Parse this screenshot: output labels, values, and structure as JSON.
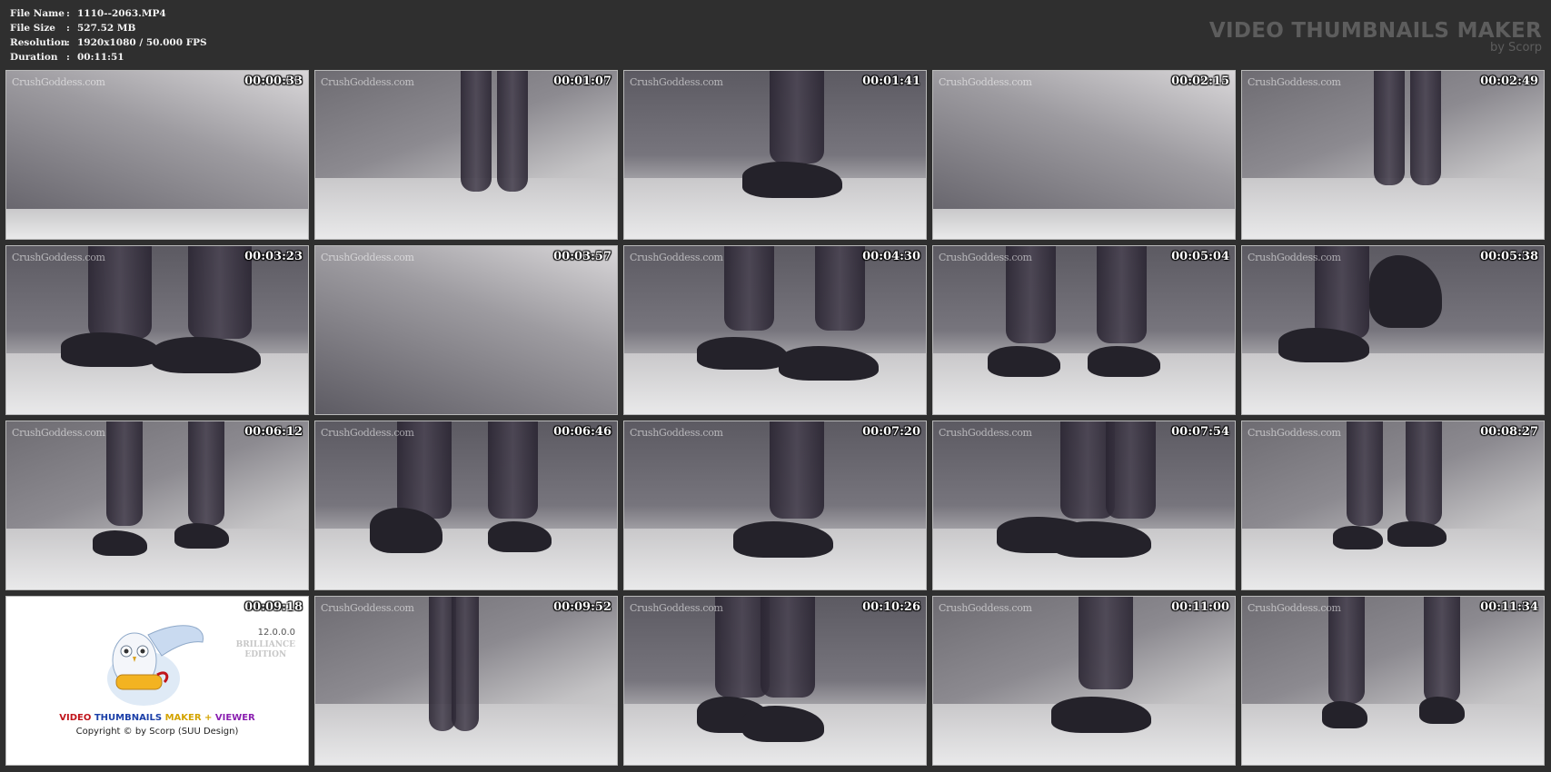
{
  "info": {
    "rows": [
      {
        "key": "File Name",
        "sep": ":",
        "value": "1110--2063.MP4"
      },
      {
        "key": "File Size",
        "sep": ":",
        "value": "527.52 MB"
      },
      {
        "key": "Resolution",
        "sep": ":",
        "value": "1920x1080 / 50.000 FPS"
      },
      {
        "key": "Duration",
        "sep": ":",
        "value": "00:11:51"
      }
    ]
  },
  "brand": {
    "title": "VIDEO THUMBNAILS MAKER",
    "subtitle": "by Scorp"
  },
  "thumbnails": [
    {
      "time": "00:00:33",
      "watermark": "CrushGoddess.com"
    },
    {
      "time": "00:01:07",
      "watermark": "CrushGoddess.com"
    },
    {
      "time": "00:01:41",
      "watermark": "CrushGoddess.com"
    },
    {
      "time": "00:02:15",
      "watermark": "CrushGoddess.com"
    },
    {
      "time": "00:02:49",
      "watermark": "CrushGoddess.com"
    },
    {
      "time": "00:03:23",
      "watermark": "CrushGoddess.com"
    },
    {
      "time": "00:03:57",
      "watermark": "CrushGoddess.com"
    },
    {
      "time": "00:04:30",
      "watermark": "CrushGoddess.com"
    },
    {
      "time": "00:05:04",
      "watermark": "CrushGoddess.com"
    },
    {
      "time": "00:05:38",
      "watermark": "CrushGoddess.com"
    },
    {
      "time": "00:06:12",
      "watermark": "CrushGoddess.com"
    },
    {
      "time": "00:06:46",
      "watermark": "CrushGoddess.com"
    },
    {
      "time": "00:07:20",
      "watermark": "CrushGoddess.com"
    },
    {
      "time": "00:07:54",
      "watermark": "CrushGoddess.com"
    },
    {
      "time": "00:08:27",
      "watermark": "CrushGoddess.com"
    },
    {
      "time": "00:09:18",
      "watermark": ""
    },
    {
      "time": "00:09:52",
      "watermark": "CrushGoddess.com"
    },
    {
      "time": "00:10:26",
      "watermark": "CrushGoddess.com"
    },
    {
      "time": "00:11:00",
      "watermark": "CrushGoddess.com"
    },
    {
      "time": "00:11:34",
      "watermark": "CrushGoddess.com"
    }
  ],
  "logo_tile": {
    "version": "12.0.0.0",
    "edition_line1": "BRILLIANCE",
    "edition_line2": "EDITION",
    "name_w1": "VIDEO",
    "name_w2": "THUMBNAILS",
    "name_w3": "MAKER + ",
    "name_w4": "VIEWER",
    "copyright": "Copyright © by Scorp (SUU Design)"
  },
  "colors": {
    "background": "#2f2f2f",
    "brand_text": "#5d5d5d",
    "thumb_border": "#b9b9b9"
  }
}
